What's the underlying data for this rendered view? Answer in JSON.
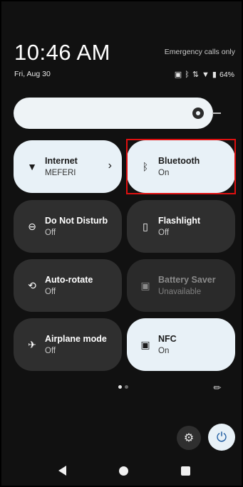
{
  "header": {
    "time": "10:46 AM",
    "emergency": "Emergency calls only",
    "date": "Fri, Aug 30",
    "battery": "64%"
  },
  "tiles": [
    {
      "title": "Internet",
      "subtitle": "MEFERI",
      "state": "on",
      "icon": "wifi-icon"
    },
    {
      "title": "Bluetooth",
      "subtitle": "On",
      "state": "on",
      "icon": "bluetooth-icon"
    },
    {
      "title": "Do Not Disturb",
      "subtitle": "Off",
      "state": "off",
      "icon": "dnd-icon"
    },
    {
      "title": "Flashlight",
      "subtitle": "Off",
      "state": "off",
      "icon": "flashlight-icon"
    },
    {
      "title": "Auto-rotate",
      "subtitle": "Off",
      "state": "off",
      "icon": "rotate-icon"
    },
    {
      "title": "Battery Saver",
      "subtitle": "Unavailable",
      "state": "disabled",
      "icon": "battery-saver-icon"
    },
    {
      "title": "Airplane mode",
      "subtitle": "Off",
      "state": "off",
      "icon": "airplane-icon"
    },
    {
      "title": "NFC",
      "subtitle": "On",
      "state": "on",
      "icon": "nfc-icon"
    }
  ],
  "colors": {
    "tile_on": "#e8f1f7",
    "tile_off": "#2f2f2f",
    "highlight": "#e01010"
  }
}
